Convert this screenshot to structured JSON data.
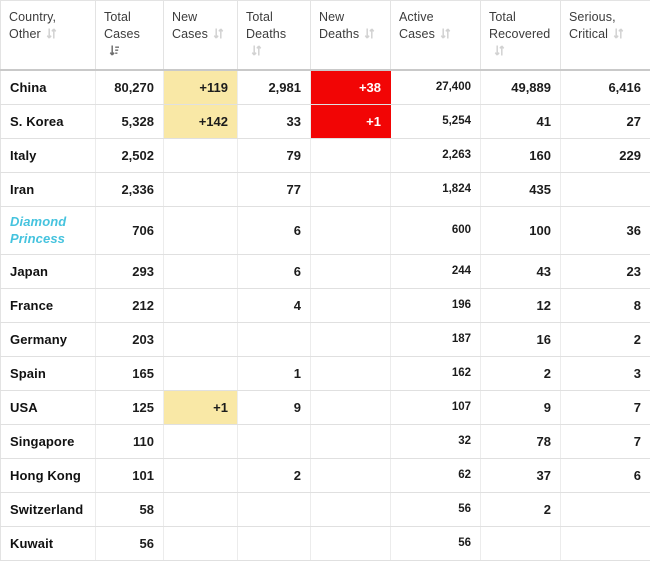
{
  "table": {
    "columns": [
      {
        "label": "Country,\nOther",
        "line1": "Country,",
        "line2": "Other",
        "sort_icon": "sort-both-icon",
        "sort_state": "none"
      },
      {
        "label": "Total Cases",
        "line1": "Total",
        "line2": "Cases",
        "sort_icon": "sort-descending-icon",
        "sort_state": "descending"
      },
      {
        "label": "New Cases",
        "line1": "New",
        "line2": "Cases",
        "sort_icon": "sort-both-icon",
        "sort_state": "none"
      },
      {
        "label": "Total Deaths",
        "line1": "Total",
        "line2": "Deaths",
        "sort_icon": "sort-both-icon",
        "sort_state": "none"
      },
      {
        "label": "New Deaths",
        "line1": "New",
        "line2": "Deaths",
        "sort_icon": "sort-both-icon",
        "sort_state": "none"
      },
      {
        "label": "Active Cases",
        "line1": "Active",
        "line2": "Cases",
        "sort_icon": "sort-both-icon",
        "sort_state": "none"
      },
      {
        "label": "Total Recovered",
        "line1": "Total",
        "line2": "Recovered",
        "sort_icon": "sort-both-icon",
        "sort_state": "none"
      },
      {
        "label": "Serious, Critical",
        "line1": "Serious,",
        "line2": "Critical",
        "sort_icon": "sort-both-icon",
        "sort_state": "none"
      }
    ],
    "rows": [
      {
        "country": "China",
        "total_cases": "80,270",
        "new_cases": "+119",
        "total_deaths": "2,981",
        "new_deaths": "+38",
        "active_cases": "27,400",
        "total_recovered": "49,889",
        "serious_critical": "6,416"
      },
      {
        "country": "S. Korea",
        "total_cases": "5,328",
        "new_cases": "+142",
        "total_deaths": "33",
        "new_deaths": "+1",
        "active_cases": "5,254",
        "total_recovered": "41",
        "serious_critical": "27"
      },
      {
        "country": "Italy",
        "total_cases": "2,502",
        "new_cases": "",
        "total_deaths": "79",
        "new_deaths": "",
        "active_cases": "2,263",
        "total_recovered": "160",
        "serious_critical": "229"
      },
      {
        "country": "Iran",
        "total_cases": "2,336",
        "new_cases": "",
        "total_deaths": "77",
        "new_deaths": "",
        "active_cases": "1,824",
        "total_recovered": "435",
        "serious_critical": ""
      },
      {
        "country": "Diamond Princess",
        "total_cases": "706",
        "new_cases": "",
        "total_deaths": "6",
        "new_deaths": "",
        "active_cases": "600",
        "total_recovered": "100",
        "serious_critical": "36"
      },
      {
        "country": "Japan",
        "total_cases": "293",
        "new_cases": "",
        "total_deaths": "6",
        "new_deaths": "",
        "active_cases": "244",
        "total_recovered": "43",
        "serious_critical": "23"
      },
      {
        "country": "France",
        "total_cases": "212",
        "new_cases": "",
        "total_deaths": "4",
        "new_deaths": "",
        "active_cases": "196",
        "total_recovered": "12",
        "serious_critical": "8"
      },
      {
        "country": "Germany",
        "total_cases": "203",
        "new_cases": "",
        "total_deaths": "",
        "new_deaths": "",
        "active_cases": "187",
        "total_recovered": "16",
        "serious_critical": "2"
      },
      {
        "country": "Spain",
        "total_cases": "165",
        "new_cases": "",
        "total_deaths": "1",
        "new_deaths": "",
        "active_cases": "162",
        "total_recovered": "2",
        "serious_critical": "3"
      },
      {
        "country": "USA",
        "total_cases": "125",
        "new_cases": "+1",
        "total_deaths": "9",
        "new_deaths": "",
        "active_cases": "107",
        "total_recovered": "9",
        "serious_critical": "7"
      },
      {
        "country": "Singapore",
        "total_cases": "110",
        "new_cases": "",
        "total_deaths": "",
        "new_deaths": "",
        "active_cases": "32",
        "total_recovered": "78",
        "serious_critical": "7"
      },
      {
        "country": "Hong Kong",
        "total_cases": "101",
        "new_cases": "",
        "total_deaths": "2",
        "new_deaths": "",
        "active_cases": "62",
        "total_recovered": "37",
        "serious_critical": "6"
      },
      {
        "country": "Switzerland",
        "total_cases": "58",
        "new_cases": "",
        "total_deaths": "",
        "new_deaths": "",
        "active_cases": "56",
        "total_recovered": "2",
        "serious_critical": ""
      },
      {
        "country": "Kuwait",
        "total_cases": "56",
        "new_cases": "",
        "total_deaths": "",
        "new_deaths": "",
        "active_cases": "56",
        "total_recovered": "",
        "serious_critical": ""
      }
    ]
  },
  "colors": {
    "new_cases_highlight": "#f9e8a6",
    "new_deaths_highlight": "#f20505",
    "new_deaths_text": "#ffffff",
    "special_row_text": "#45c3de",
    "header_text": "#3c3c3c",
    "body_text": "#1c1c1c",
    "sort_icon_inactive": "#d2d2d2",
    "sort_icon_active": "#6e6e6e"
  }
}
